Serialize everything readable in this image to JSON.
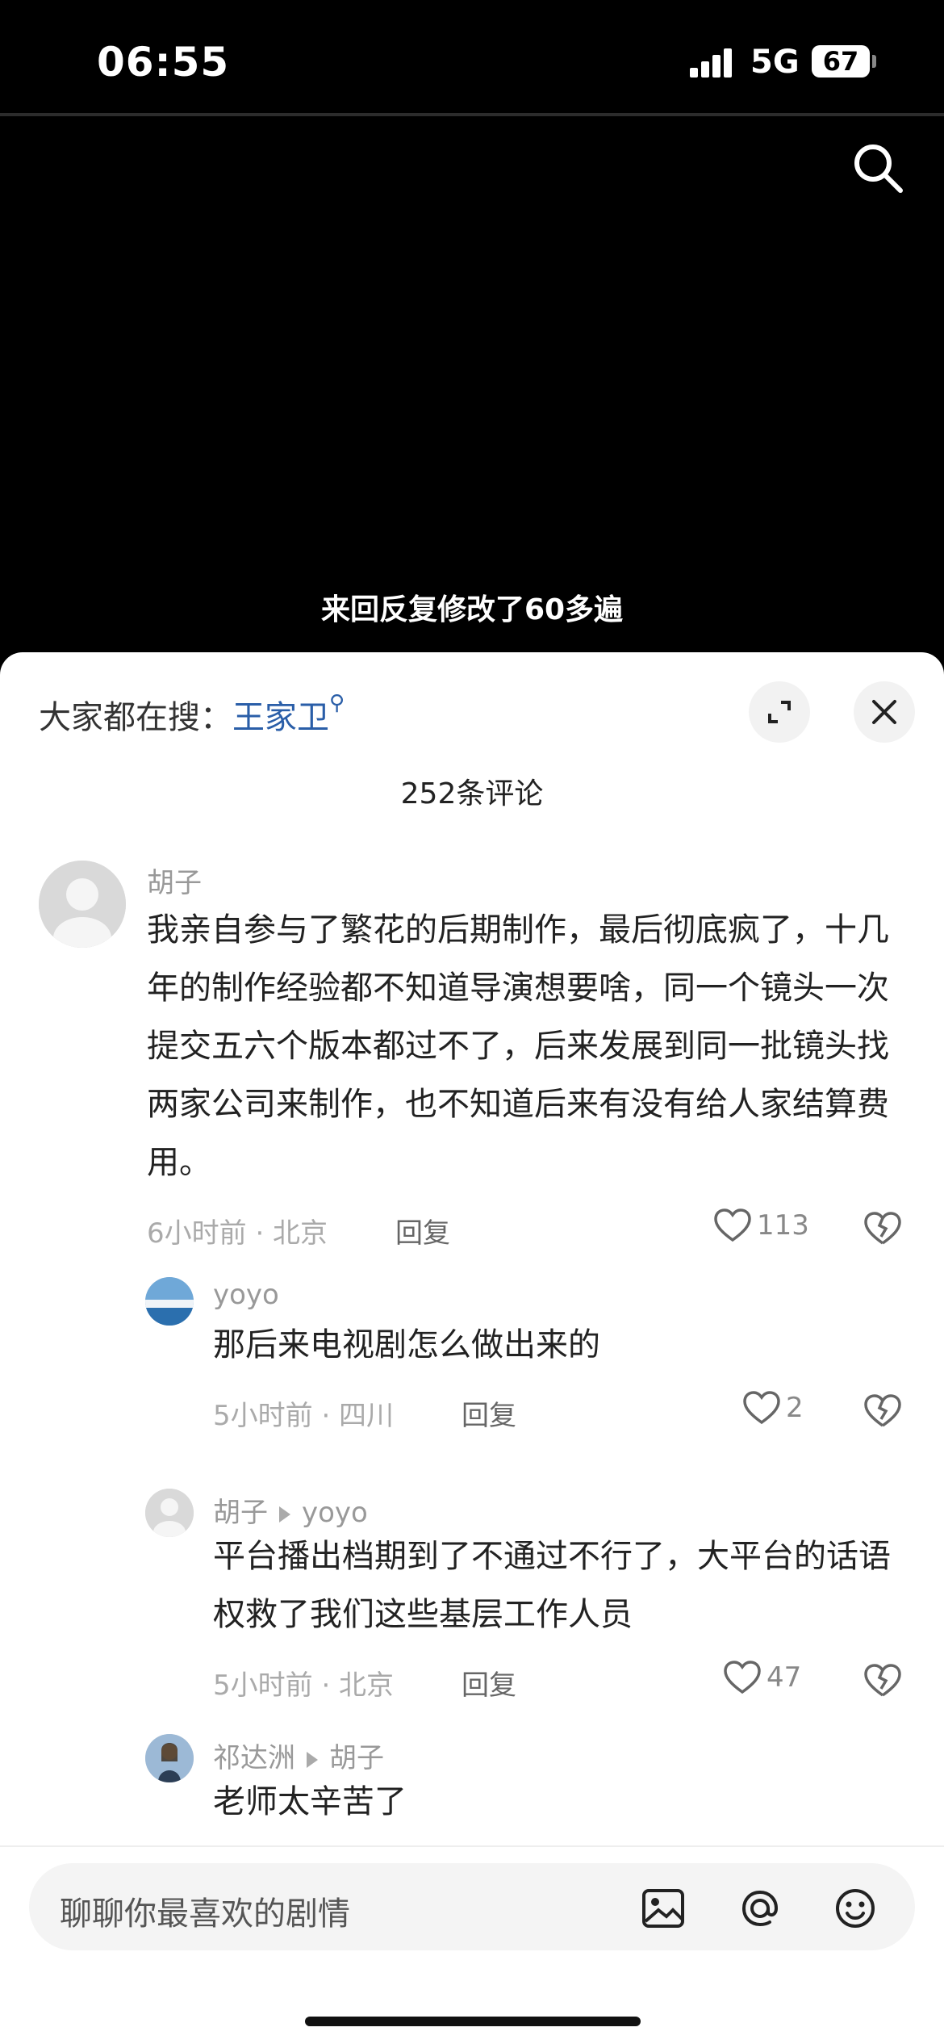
{
  "status": {
    "time": "06:55",
    "network": "5G",
    "battery": "67"
  },
  "video": {
    "subtitle": "来回反复修改了60多遍"
  },
  "sheet": {
    "trending_prefix": "大家都在搜：",
    "trending_keyword": "王家卫",
    "comment_count": "252条评论"
  },
  "comments": [
    {
      "user": "胡子",
      "text": "我亲自参与了繁花的后期制作，最后彻底疯了，十几年的制作经验都不知道导演想要啥，同一个镜头一次提交五六个版本都过不了，后来发展到同一批镜头找两家公司来制作，也不知道后来有没有给人家结算费用。",
      "meta": "6小时前 · 北京",
      "reply": "回复",
      "likes": "113"
    },
    {
      "user": "yoyo",
      "text": "那后来电视剧怎么做出来的",
      "meta": "5小时前 · 四川",
      "reply": "回复",
      "likes": "2"
    },
    {
      "user": "胡子",
      "reply_to": "yoyo",
      "text": "平台播出档期到了不通过不行了，大平台的话语权救了我们这些基层工作人员",
      "meta": "5小时前 · 北京",
      "reply": "回复",
      "likes": "47"
    },
    {
      "user": "祁达洲",
      "reply_to": "胡子",
      "text": "老师太辛苦了",
      "meta": "",
      "reply": "",
      "likes": ""
    }
  ],
  "input": {
    "placeholder": "聊聊你最喜欢的剧情"
  },
  "icons": {
    "search": "search-icon",
    "expand": "expand-icon",
    "close": "close-icon",
    "like": "heart-icon",
    "dislike": "broken-heart-icon",
    "image": "image-icon",
    "mention": "at-icon",
    "emoji": "emoji-icon"
  }
}
